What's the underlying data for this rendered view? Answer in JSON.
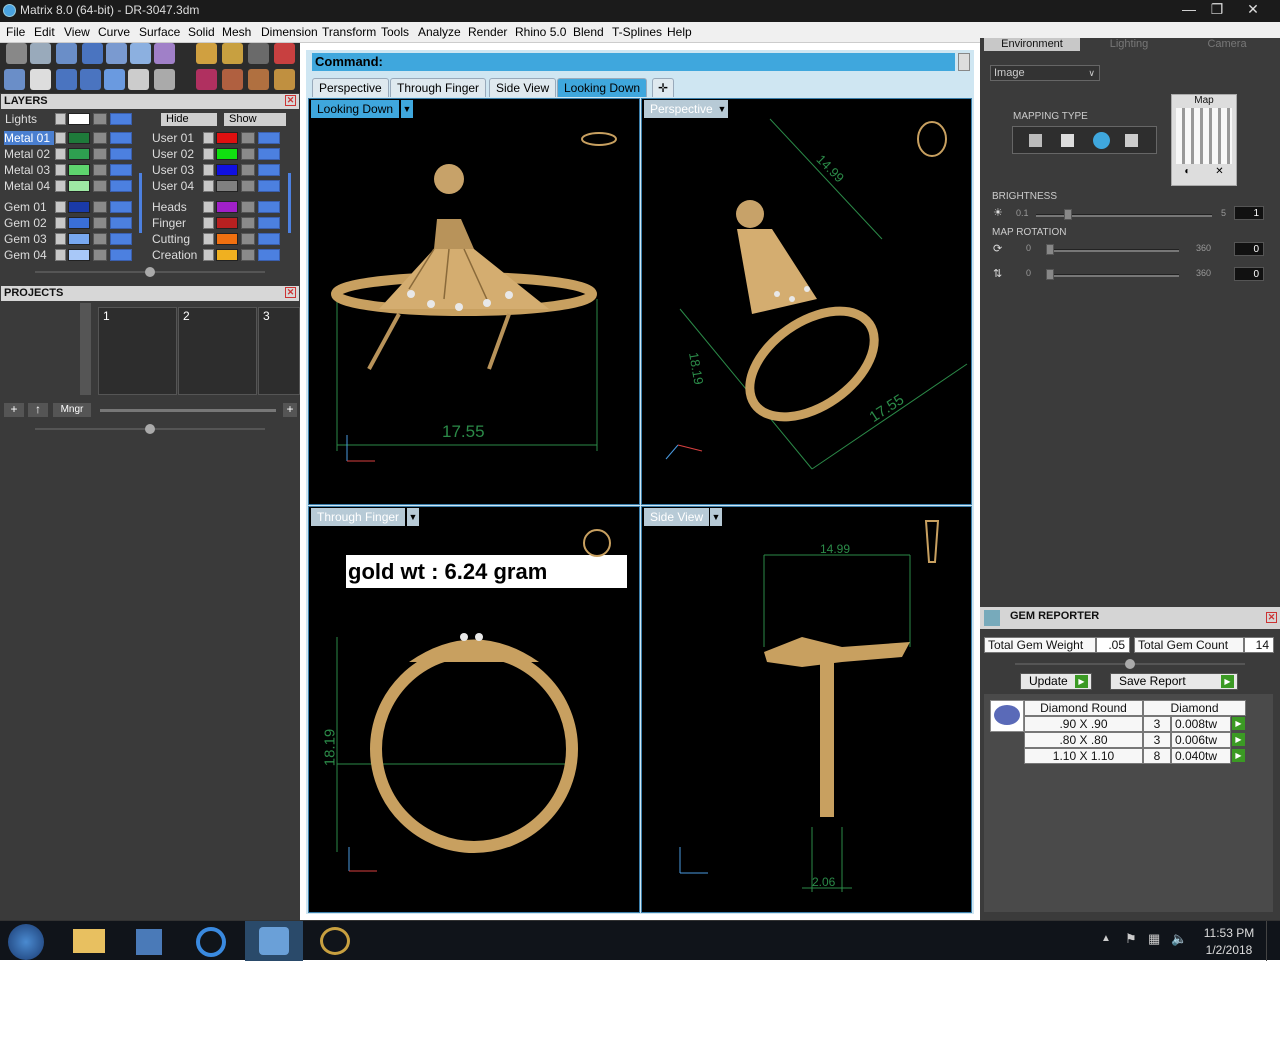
{
  "window": {
    "title": "Matrix 8.0 (64-bit) - DR-3047.3dm"
  },
  "menu": [
    "File",
    "Edit",
    "View",
    "Curve",
    "Surface",
    "Solid",
    "Mesh",
    "Dimension",
    "Transform",
    "Tools",
    "Analyze",
    "Render",
    "Rhino 5.0",
    "Blend",
    "T-Splines",
    "Help"
  ],
  "layers": {
    "title": "LAYERS",
    "lights_label": "Lights",
    "hide_label": "Hide",
    "show_label": "Show",
    "left": [
      {
        "name": "Metal 01",
        "color": "#1e7a3a",
        "selected": true
      },
      {
        "name": "Metal 02",
        "color": "#2e9f50"
      },
      {
        "name": "Metal 03",
        "color": "#5ed46e"
      },
      {
        "name": "Metal 04",
        "color": "#9ee8a4"
      },
      {
        "name": "Gem 01",
        "color": "#1a3aa8"
      },
      {
        "name": "Gem 02",
        "color": "#3a6fd8"
      },
      {
        "name": "Gem 03",
        "color": "#78a8f0"
      },
      {
        "name": "Gem 04",
        "color": "#a8c8f8"
      }
    ],
    "right": [
      {
        "name": "User 01",
        "color": "#e01010"
      },
      {
        "name": "User 02",
        "color": "#10e010"
      },
      {
        "name": "User 03",
        "color": "#1010e0"
      },
      {
        "name": "User 04",
        "color": "#808080"
      },
      {
        "name": "Heads",
        "color": "#a020c8"
      },
      {
        "name": "Finger",
        "color": "#b82020"
      },
      {
        "name": "Cutting",
        "color": "#f07010"
      },
      {
        "name": "Creation",
        "color": "#f0b020"
      }
    ]
  },
  "projects": {
    "title": "PROJECTS",
    "slots": [
      "1",
      "2",
      "3"
    ],
    "mngr": "Mngr"
  },
  "command": {
    "label": "Command:"
  },
  "tabs": [
    {
      "label": "Perspective",
      "active": false
    },
    {
      "label": "Through Finger",
      "active": false
    },
    {
      "label": "Side View",
      "active": false
    },
    {
      "label": "Looking Down",
      "active": true
    }
  ],
  "viewports": {
    "looking_down": {
      "label": "Looking Down",
      "dim": "17.55"
    },
    "perspective": {
      "label": "Perspective",
      "dim1": "14.99",
      "dim2": "18.19",
      "dim3": "17.55"
    },
    "through_finger": {
      "label": "Through Finger",
      "dim": "18.19",
      "annotation": "gold wt : 6.24 gram"
    },
    "side_view": {
      "label": "Side View",
      "dim1": "14.99",
      "dim2": "2.06"
    }
  },
  "environment": {
    "tabs": [
      "Environment",
      "Lighting",
      "Camera"
    ],
    "dropdown": "Image",
    "map_label": "Map",
    "mapping_type": "MAPPING TYPE",
    "brightness": {
      "label": "BRIGHTNESS",
      "min": "0.1",
      "max": "5",
      "value": "1"
    },
    "map_rotation": {
      "label": "MAP ROTATION",
      "rows": [
        {
          "min": "0",
          "max": "360",
          "value": "0"
        },
        {
          "min": "0",
          "max": "360",
          "value": "0"
        }
      ]
    }
  },
  "gem_reporter": {
    "title": "GEM REPORTER",
    "total_weight_label": "Total Gem Weight",
    "total_weight": ".05",
    "total_count_label": "Total Gem Count",
    "total_count": "14",
    "update": "Update",
    "save_report": "Save Report",
    "col1": "Diamond Round",
    "col2": "Diamond",
    "rows": [
      {
        "size": ".90 X .90",
        "qty": "3",
        "wt": "0.008tw"
      },
      {
        "size": ".80 X .80",
        "qty": "3",
        "wt": "0.006tw"
      },
      {
        "size": "1.10 X 1.10",
        "qty": "8",
        "wt": "0.040tw"
      }
    ]
  },
  "clock": {
    "time": "11:53 PM",
    "date": "1/2/2018"
  }
}
